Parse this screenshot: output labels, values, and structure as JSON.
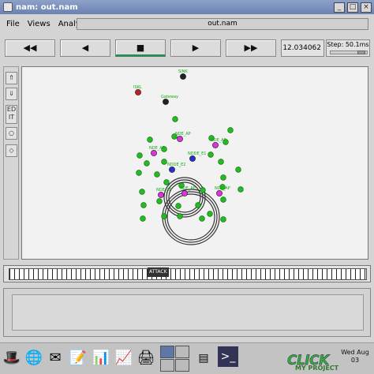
{
  "window": {
    "title": "nam: out.nam"
  },
  "menu": {
    "items": [
      "File",
      "Views",
      "Analysis"
    ],
    "filename": "out.nam"
  },
  "toolbar": {
    "rewind": "◀◀",
    "back": "◀",
    "stop": "■",
    "play": "▶",
    "fastforward": "▶▶",
    "time": "12.034062",
    "step": "Step: 50.1ms"
  },
  "side_tools": {
    "edit_label": "ED\nIT"
  },
  "timeline": {
    "marker_label": "ATTACK"
  },
  "canvas": {
    "nodes": [
      {
        "label": "SINK",
        "color": "#222222"
      },
      {
        "label": "ISKL",
        "color": "#bb2222"
      },
      {
        "label": "Gateway",
        "color": "#222222"
      },
      {
        "label": "NDE_AP",
        "color": "#dd33dd"
      },
      {
        "label": "NDE_AP",
        "color": "#dd33dd"
      },
      {
        "label": "NDDE_E1",
        "color": "#2233cc"
      },
      {
        "label": "NDDE_E2",
        "color": "#2233cc"
      },
      {
        "label": "NDE_AP",
        "color": "#dd33dd"
      },
      {
        "label": "NDE_AP",
        "color": "#dd33dd"
      },
      {
        "label": "NDE_AP",
        "color": "#dd33dd"
      },
      {
        "label": "NDE_AP",
        "color": "#dd33dd"
      }
    ]
  },
  "taskbar": {
    "clock": "Wed Aug 03"
  },
  "brand": {
    "line1": "CLICK",
    "line2": "MY PROJECT"
  }
}
